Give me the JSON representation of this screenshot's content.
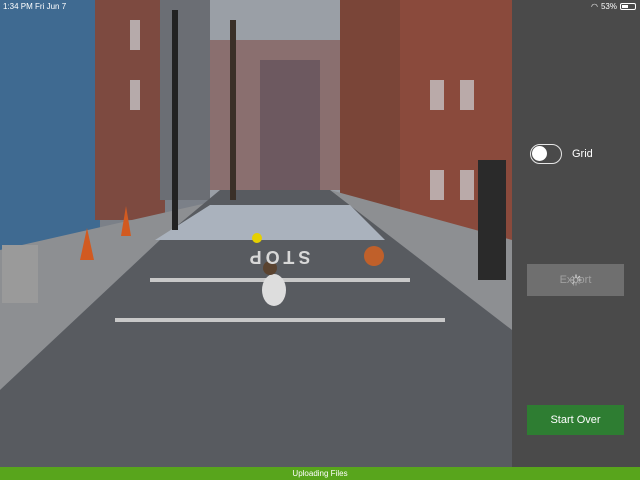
{
  "status": {
    "time_date": "1:34 PM  Fri Jun 7",
    "battery": "53%",
    "battery_level": 0.53
  },
  "scene": {
    "street_text": "STOP"
  },
  "panel": {
    "grid_label": "Grid",
    "grid_on": false,
    "export_label": "Export",
    "start_over_label": "Start Over"
  },
  "footer": {
    "upload_text": "Uploading Files"
  },
  "colors": {
    "start_over": "#2e7d32",
    "upload_bar": "#58a51c",
    "panel": "#4a4a4a"
  }
}
